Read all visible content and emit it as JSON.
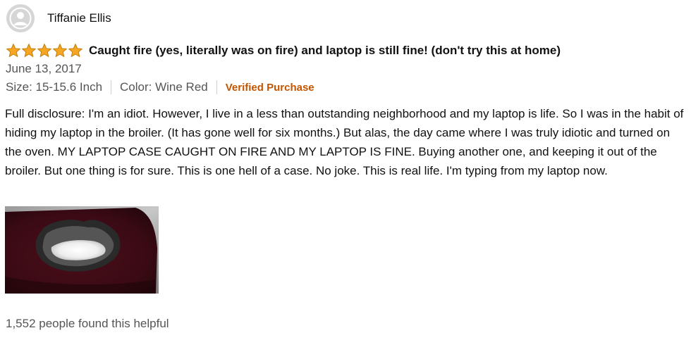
{
  "review": {
    "author": "Tiffanie Ellis",
    "rating": 5,
    "rating_max": 5,
    "title": "Caught fire (yes, literally was on fire) and laptop is still fine! (don't try this at home)",
    "date": "June 13, 2017",
    "size": "Size: 15-15.6 Inch",
    "color": "Color: Wine Red",
    "verified": "Verified Purchase",
    "body": "Full disclosure: I'm an idiot. However, I live in a less than outstanding neighborhood and my laptop is life. So I was in the habit of hiding my laptop in the broiler. (It has gone well for six months.) But alas, the day came where I was truly idiotic and turned on the oven. MY LAPTOP CASE CAUGHT ON FIRE AND MY LAPTOP IS FINE. Buying another one, and keeping it out of the broiler. But one thing is for sure. This is one hell of a case. No joke. This is real life. I'm typing from my laptop now.",
    "helpful": "1,552 people found this helpful"
  },
  "icons": {
    "avatar": "default-user-avatar-icon",
    "star": "star-icon"
  },
  "colors": {
    "star": "#f6a623",
    "star_outline": "#c48410",
    "verified": "#c45500",
    "secondary_text": "#555555",
    "case_wine_red": "#5a1020"
  }
}
